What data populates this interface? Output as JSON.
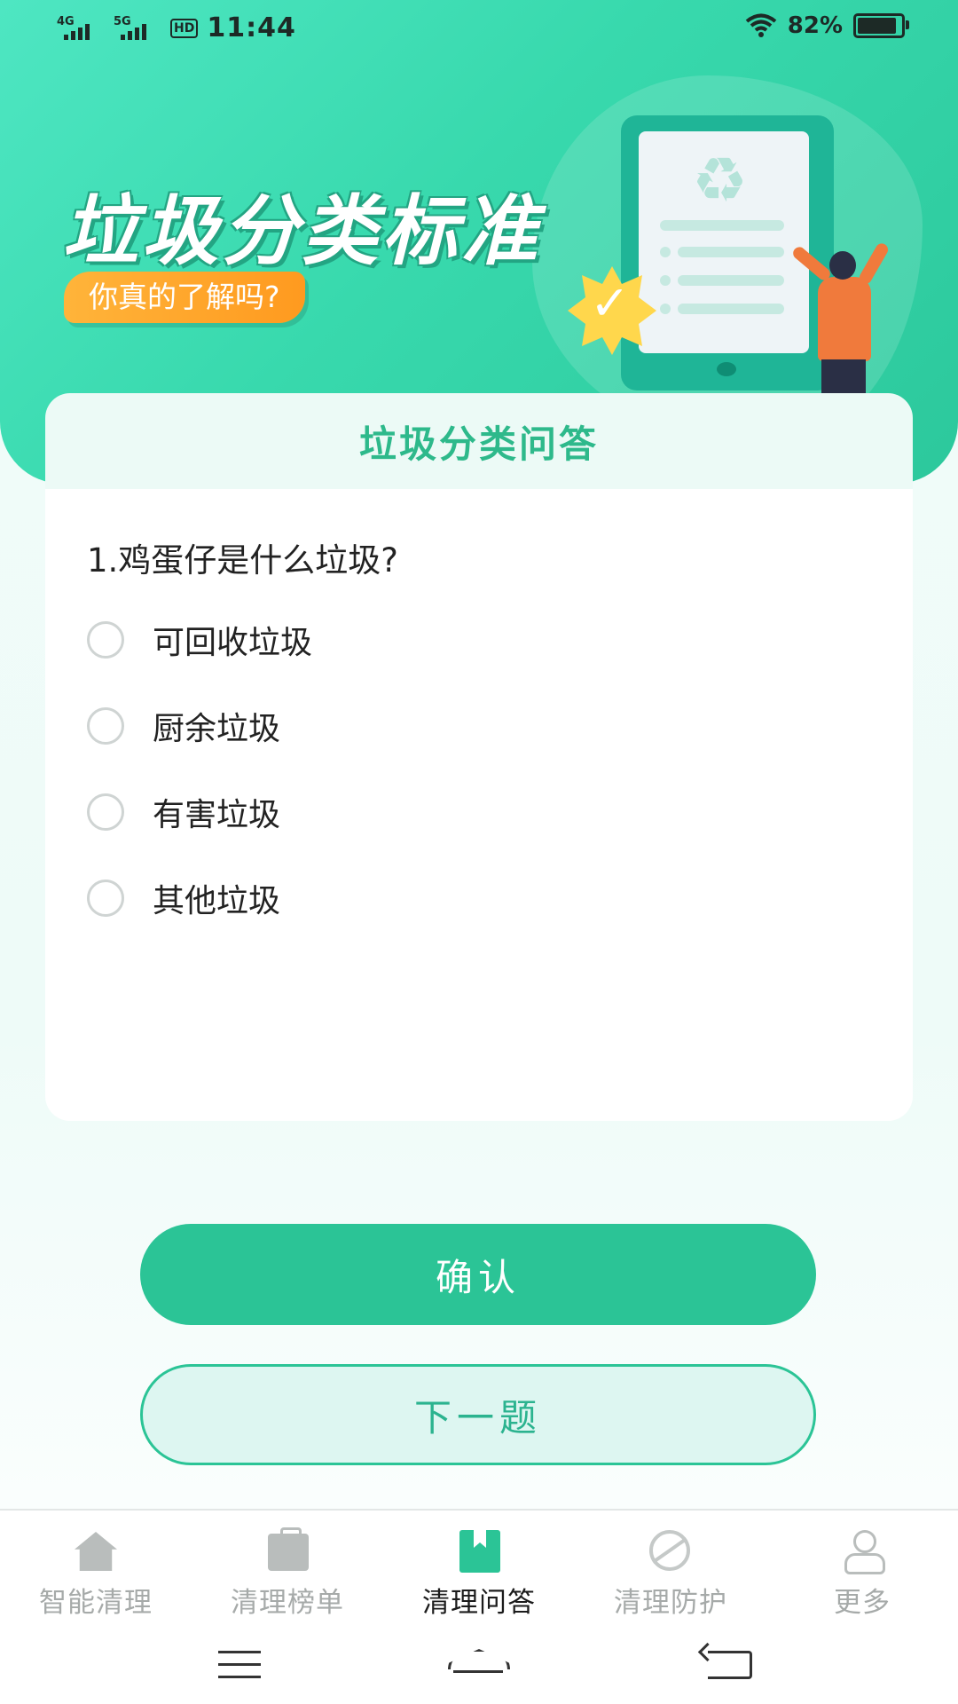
{
  "status_bar": {
    "network1": "4G",
    "network2": "5G",
    "hd": "HD",
    "time": "11:44",
    "battery_percent": "82%",
    "battery_level": 0.82,
    "icons": [
      "signal-icon",
      "wifi-icon",
      "battery-icon"
    ]
  },
  "hero": {
    "title": "垃圾分类标准",
    "subtitle": "你真的了解吗?",
    "colors": {
      "gradient_start": "#4ee6c2",
      "gradient_end": "#2cc89c",
      "pill": "#ff9a1f"
    }
  },
  "quiz": {
    "title": "垃圾分类问答",
    "question": "1.鸡蛋仔是什么垃圾?",
    "options": [
      {
        "label": "可回收垃圾",
        "selected": false
      },
      {
        "label": "厨余垃圾",
        "selected": false
      },
      {
        "label": "有害垃圾",
        "selected": false
      },
      {
        "label": "其他垃圾",
        "selected": false
      }
    ]
  },
  "actions": {
    "confirm_label": "确认",
    "next_label": "下一题",
    "accent_color": "#2bc496"
  },
  "tabbar": {
    "items": [
      {
        "label": "智能清理",
        "icon": "home-upload-icon",
        "active": false
      },
      {
        "label": "清理榜单",
        "icon": "trash-bag-icon",
        "active": false
      },
      {
        "label": "清理问答",
        "icon": "book-icon",
        "active": true
      },
      {
        "label": "清理防护",
        "icon": "camera-off-icon",
        "active": false
      },
      {
        "label": "更多",
        "icon": "user-icon",
        "active": false
      }
    ]
  },
  "system_nav": [
    "menu-icon",
    "home-icon",
    "back-icon"
  ]
}
